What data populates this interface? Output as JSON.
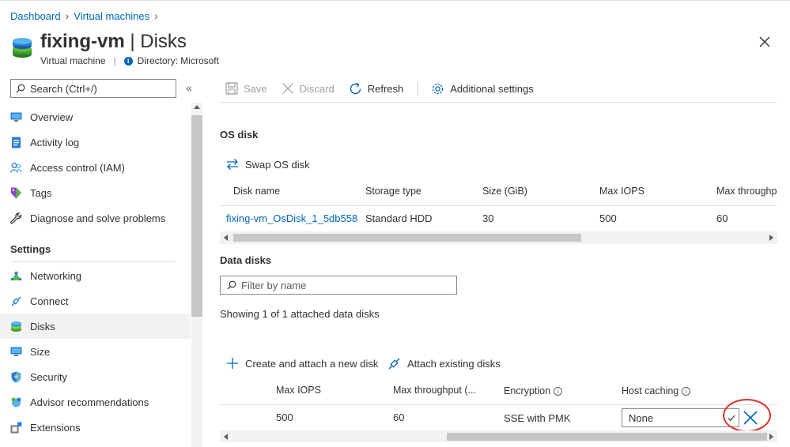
{
  "breadcrumb": {
    "items": [
      "Dashboard",
      "Virtual machines"
    ]
  },
  "header": {
    "name": "fixing-vm",
    "sep": "|",
    "page": "Disks",
    "type": "Virtual machine",
    "directory": "Directory: Microsoft"
  },
  "search": {
    "placeholder": "Search (Ctrl+/)"
  },
  "sidebar": {
    "items": [
      {
        "label": "Overview",
        "icon": "monitor-icon"
      },
      {
        "label": "Activity log",
        "icon": "log-icon"
      },
      {
        "label": "Access control (IAM)",
        "icon": "people-icon"
      },
      {
        "label": "Tags",
        "icon": "tag-icon"
      },
      {
        "label": "Diagnose and solve problems",
        "icon": "wrench-icon"
      }
    ],
    "settings_label": "Settings",
    "settings_items": [
      {
        "label": "Networking",
        "icon": "network-icon"
      },
      {
        "label": "Connect",
        "icon": "connect-icon"
      },
      {
        "label": "Disks",
        "icon": "disk-icon",
        "active": true
      },
      {
        "label": "Size",
        "icon": "monitor-icon"
      },
      {
        "label": "Security",
        "icon": "shield-icon"
      },
      {
        "label": "Advisor recommendations",
        "icon": "advisor-icon"
      },
      {
        "label": "Extensions",
        "icon": "extension-icon"
      }
    ]
  },
  "toolbar": {
    "save": "Save",
    "discard": "Discard",
    "refresh": "Refresh",
    "additional": "Additional settings"
  },
  "os_disk": {
    "heading": "OS disk",
    "swap": "Swap OS disk",
    "columns": [
      "Disk name",
      "Storage type",
      "Size (GiB)",
      "Max IOPS",
      "Max throughp"
    ],
    "row": [
      "fixing-vm_OsDisk_1_5db558",
      "Standard HDD",
      "30",
      "500",
      "60"
    ]
  },
  "data_disks": {
    "heading": "Data disks",
    "filter_placeholder": "Filter by name",
    "showing": "Showing 1 of 1 attached data disks",
    "create": "Create and attach a new disk",
    "attach": "Attach existing disks",
    "columns": [
      "Max IOPS",
      "Max throughput (...",
      "Encryption",
      "Host caching"
    ],
    "row": [
      "500",
      "60",
      "SSE with PMK"
    ],
    "host_caching_value": "None"
  },
  "colors": {
    "accent": "#0066b8",
    "highlight": "#d9332c"
  }
}
